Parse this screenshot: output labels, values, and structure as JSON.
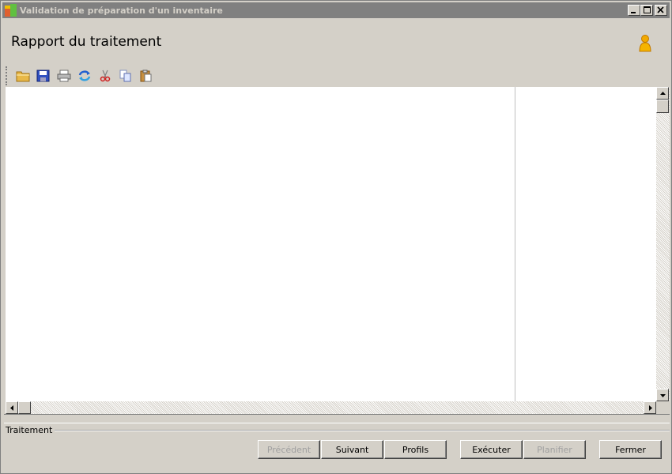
{
  "window": {
    "title": "Validation de préparation d'un inventaire",
    "minimize_icon": "minimize-icon",
    "maximize_icon": "maximize-icon",
    "close_icon": "close-icon"
  },
  "header": {
    "title": "Rapport du traitement",
    "user_icon": "user-icon"
  },
  "toolbar": {
    "items": [
      {
        "icon": "open-folder-icon",
        "enabled": true
      },
      {
        "icon": "save-icon",
        "enabled": true
      },
      {
        "icon": "print-icon",
        "enabled": true
      },
      {
        "icon": "refresh-icon",
        "enabled": true
      },
      {
        "icon": "cut-icon",
        "enabled": true
      },
      {
        "icon": "copy-icon",
        "enabled": true
      },
      {
        "icon": "paste-icon",
        "enabled": true
      }
    ]
  },
  "section": {
    "label": "Traitement"
  },
  "buttons": {
    "previous": "Précédent",
    "next": "Suivant",
    "profiles": "Profils",
    "execute": "Exécuter",
    "schedule": "Planifier",
    "close": "Fermer"
  },
  "colors": {
    "window_bg": "#d4d0c8",
    "titlebar_bg": "#808080",
    "disabled_text": "#a0a0a0"
  }
}
